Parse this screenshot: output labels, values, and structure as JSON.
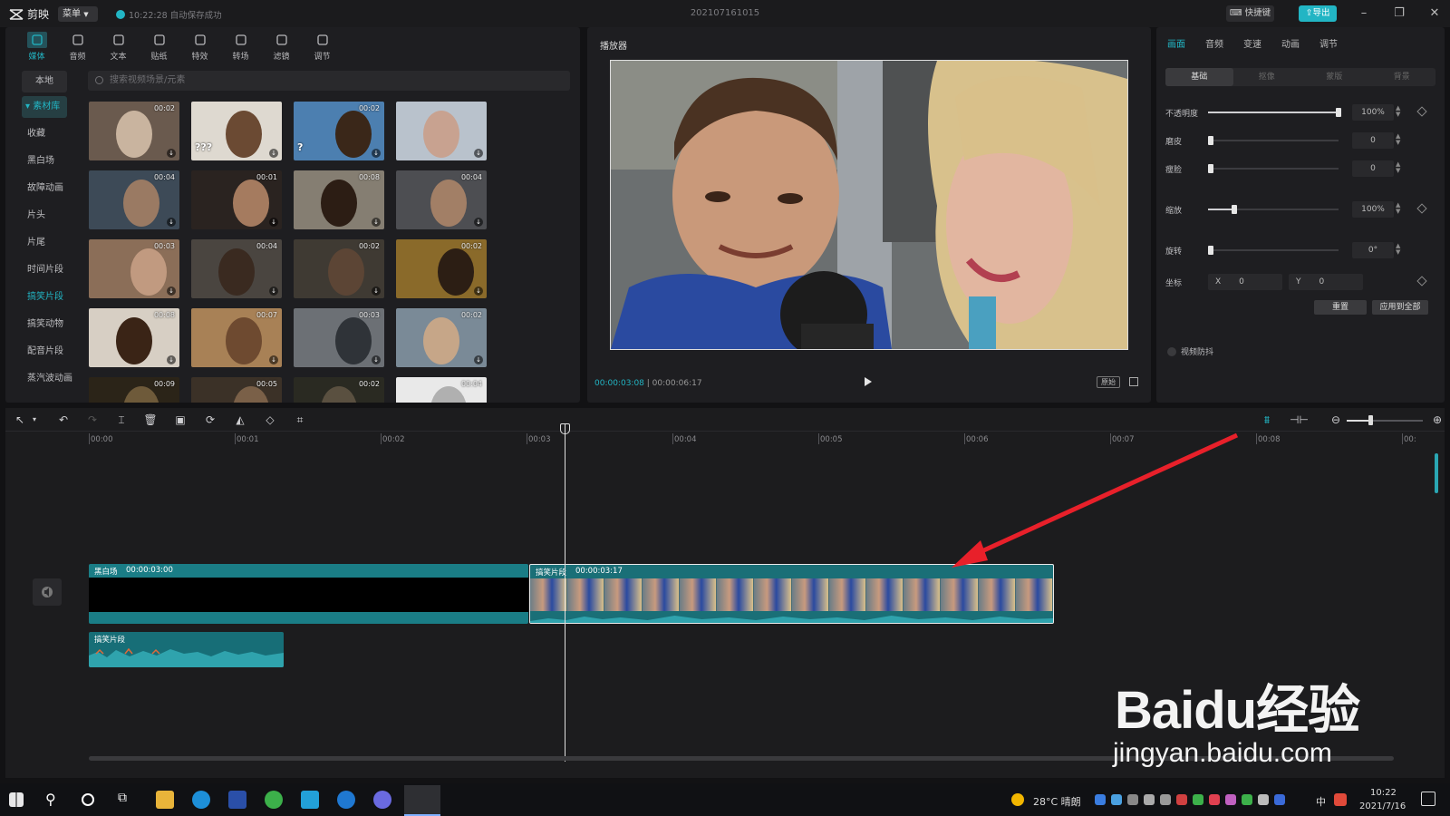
{
  "app": {
    "name": "剪映",
    "menu_label": "菜单",
    "autosave_text": "10:22:28 自动保存成功",
    "project_title": "202107161015",
    "shortcut_label": "快捷键",
    "export_label": "导出"
  },
  "toolbar": {
    "tabs": [
      {
        "label": "媒体",
        "icon": "media-icon"
      },
      {
        "label": "音频",
        "icon": "audio-icon"
      },
      {
        "label": "文本",
        "icon": "text-icon"
      },
      {
        "label": "贴纸",
        "icon": "sticker-icon"
      },
      {
        "label": "特效",
        "icon": "effects-icon"
      },
      {
        "label": "转场",
        "icon": "transition-icon"
      },
      {
        "label": "滤镜",
        "icon": "filter-icon"
      },
      {
        "label": "调节",
        "icon": "adjust-icon"
      }
    ]
  },
  "sidebar": {
    "local": "本地",
    "library": "素材库",
    "items": [
      "收藏",
      "黑白场",
      "故障动画",
      "片头",
      "片尾",
      "时间片段",
      "搞笑片段",
      "搞笑动物",
      "配音片段",
      "蒸汽波动画"
    ]
  },
  "search": {
    "placeholder": "搜索视频场景/元素"
  },
  "thumbnails": [
    {
      "duration": "00:02",
      "bg": "#6a5a4e",
      "face": "#c9b49f"
    },
    {
      "duration": "",
      "bg": "#ded9d0",
      "face": "#6b4a33",
      "caption": "???"
    },
    {
      "duration": "00:02",
      "bg": "#4c7fb0",
      "face": "#3a2719",
      "caption": "?"
    },
    {
      "duration": "",
      "bg": "#b9c2cc",
      "face": "#c8a290"
    },
    {
      "duration": "00:04",
      "bg": "#3d4a57",
      "face": "#9a7a63"
    },
    {
      "duration": "00:01",
      "bg": "#2a2320",
      "face": "#a57b5f"
    },
    {
      "duration": "00:08",
      "bg": "#857e72",
      "face": "#2c1d14"
    },
    {
      "duration": "00:04",
      "bg": "#4d4e52",
      "face": "#a27f66"
    },
    {
      "duration": "00:03",
      "bg": "#8b6e58",
      "face": "#c19a80"
    },
    {
      "duration": "00:04",
      "bg": "#4a4540",
      "face": "#3a2a20"
    },
    {
      "duration": "00:02",
      "bg": "#3f3a33",
      "face": "#5c4535"
    },
    {
      "duration": "00:02",
      "bg": "#8a6a2a",
      "face": "#2c1e14"
    },
    {
      "duration": "00:08",
      "bg": "#d7cfc4",
      "face": "#3a2416"
    },
    {
      "duration": "00:07",
      "bg": "#a88156",
      "face": "#6e4a30"
    },
    {
      "duration": "00:03",
      "bg": "#6c7075",
      "face": "#2f3338"
    },
    {
      "duration": "00:02",
      "bg": "#7a8a97",
      "face": "#c6a688"
    },
    {
      "duration": "00:09",
      "bg": "#2b2418",
      "face": "#6e5a3a"
    },
    {
      "duration": "00:05",
      "bg": "#3b3127",
      "face": "#7a6048"
    },
    {
      "duration": "00:02",
      "bg": "#2a2a22",
      "face": "#5a5040"
    },
    {
      "duration": "00:04",
      "bg": "#e9e9e9",
      "face": "#b0b0b0"
    }
  ],
  "player": {
    "title": "播放器",
    "current_time": "00:00:03:08",
    "total_time": "00:00:06:17",
    "ratio_label": "原始"
  },
  "inspector": {
    "tabs": [
      "画面",
      "音频",
      "变速",
      "动画",
      "调节"
    ],
    "subtabs": [
      "基础",
      "抠像",
      "蒙版",
      "背景"
    ],
    "props": [
      {
        "label": "不透明度",
        "value": "100%",
        "level": 1.0
      },
      {
        "label": "磨皮",
        "value": "0",
        "level": 0.0
      },
      {
        "label": "瘦脸",
        "value": "0",
        "level": 0.0
      },
      {
        "label": "缩放",
        "value": "100%",
        "level": 0.2
      },
      {
        "label": "旋转",
        "value": "0°",
        "level": 0.0
      }
    ],
    "coord": {
      "label": "坐标",
      "x_label": "X",
      "x_value": "0",
      "y_label": "Y",
      "y_value": "0"
    },
    "reset_label": "重置",
    "apply_all_label": "应用到全部",
    "stabilize_label": "视频防抖"
  },
  "timeline": {
    "ruler": [
      "00:00",
      "00:01",
      "00:02",
      "00:03",
      "00:04",
      "00:05",
      "00:06",
      "00:07",
      "00:08",
      "00:"
    ],
    "clips": {
      "black": {
        "label": "黑白场",
        "duration": "00:00:03:00"
      },
      "main": {
        "label": "搞笑片段",
        "duration": "00:00:03:17"
      },
      "audio": {
        "label": "搞笑片段"
      }
    }
  },
  "taskbar": {
    "weather": "28°C 晴朗",
    "ime": "中",
    "time": "10:22",
    "date": "2021/7/16"
  },
  "watermark": {
    "logo": "Baidu经验",
    "url": "jingyan.baidu.com"
  },
  "colors": {
    "accent": "#22b5c4",
    "arrow": "#e8202a"
  }
}
